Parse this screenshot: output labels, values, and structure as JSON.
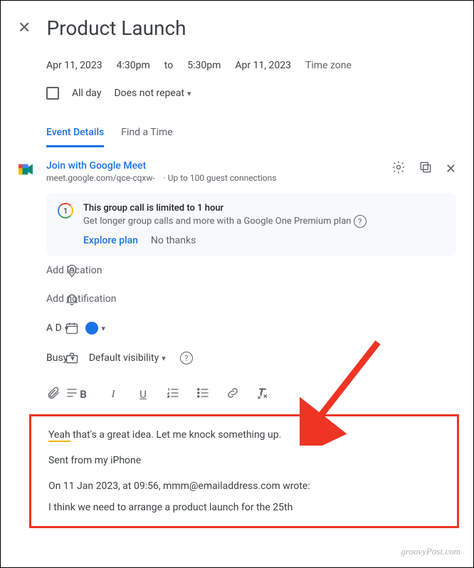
{
  "title": "Product Launch",
  "times": {
    "start_date": "Apr 11, 2023",
    "start_time": "4:30pm",
    "to": "to",
    "end_time": "5:30pm",
    "end_date": "Apr 11, 2023",
    "tz": "Time zone"
  },
  "allday": "All day",
  "repeat": "Does not repeat",
  "tabs": {
    "details": "Event Details",
    "findtime": "Find a Time"
  },
  "meet": {
    "join": "Join with Google Meet",
    "url": "meet.google.com/qce-cqxw-",
    "guests": "· Up to 100 guest connections"
  },
  "promo": {
    "title": "This group call is limited to 1 hour",
    "sub": "Get longer group calls and more with a Google One Premium plan",
    "explore": "Explore plan",
    "nothanks": "No thanks"
  },
  "location": "Add location",
  "notification": "Add notification",
  "calendar": "A D",
  "busy": "Busy",
  "visibility": "Default visibility",
  "desc": {
    "l1a": "Yeah",
    "l1b": " that's a great idea. Let me knock something up.",
    "l2": "Sent from my iPhone",
    "l3": "On 11 Jan 2023, at 09:56, mmm@emailaddress.com wrote:",
    "l4": "I think we need to arrange a product launch for the 25th"
  },
  "watermark": "groovyPost.com"
}
